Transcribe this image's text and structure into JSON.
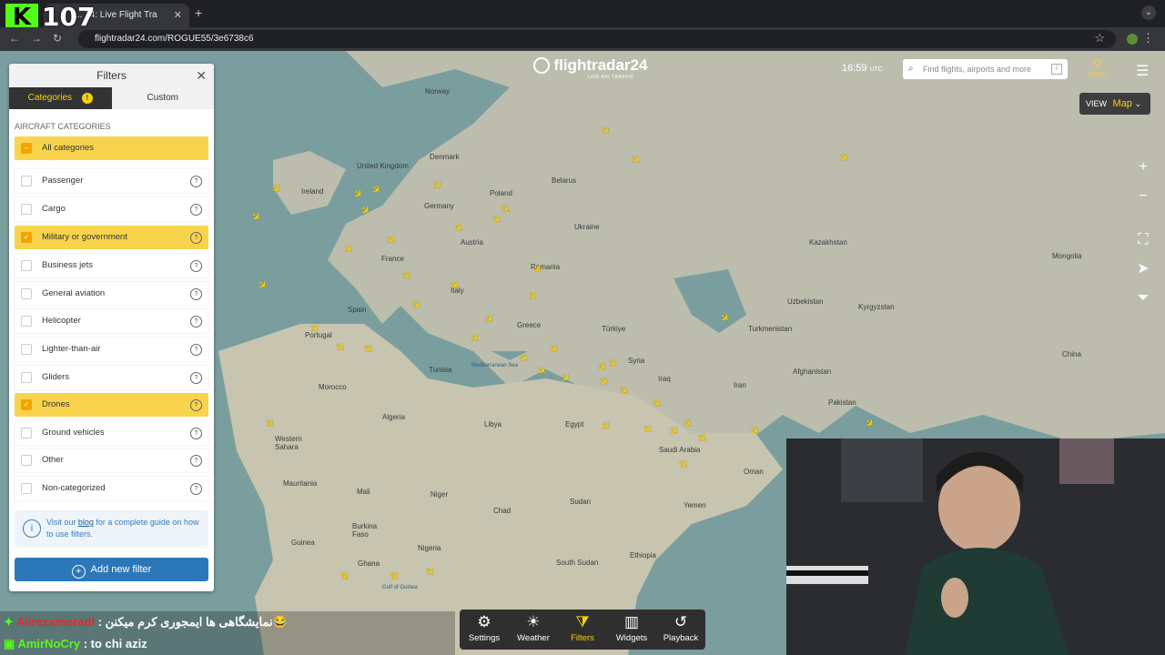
{
  "browser": {
    "tab_title": "... 24: Live Flight Tra",
    "tab_close": "✕",
    "new_tab": "+",
    "url": "flightradar24.com/ROGUE55/3e6738c6",
    "stream_brand": "K",
    "viewer_count": "107"
  },
  "header": {
    "logo": "flightradar24",
    "logo_sub": "LIVE AIR TRAFFIC",
    "time": "16:59",
    "time_zone": "UTC",
    "search_placeholder": "Find flights, airports and more",
    "search_key": "/",
    "gold_label": "GOLD",
    "view_label": "VIEW",
    "view_value": "Map"
  },
  "filters": {
    "title": "Filters",
    "tabs": [
      "Categories",
      "Custom"
    ],
    "tab_warning": "!",
    "section_title": "AIRCRAFT CATEGORIES",
    "categories": [
      {
        "label": "All categories",
        "state": "partial"
      },
      {
        "label": "Passenger",
        "state": "off"
      },
      {
        "label": "Cargo",
        "state": "off"
      },
      {
        "label": "Military or government",
        "state": "on"
      },
      {
        "label": "Business jets",
        "state": "off"
      },
      {
        "label": "General aviation",
        "state": "off"
      },
      {
        "label": "Helicopter",
        "state": "off"
      },
      {
        "label": "Lighter-than-air",
        "state": "off"
      },
      {
        "label": "Gliders",
        "state": "off"
      },
      {
        "label": "Drones",
        "state": "on"
      },
      {
        "label": "Ground vehicles",
        "state": "off"
      },
      {
        "label": "Other",
        "state": "off"
      },
      {
        "label": "Non-categorized",
        "state": "off"
      }
    ],
    "info_prefix": "Visit our ",
    "info_link": "blog",
    "info_suffix": " for a complete guide on how to use filters.",
    "add_button": "Add new filter"
  },
  "map_labels": [
    "Norway",
    "Denmark",
    "United Kingdom",
    "Ireland",
    "Belarus",
    "Poland",
    "Germany",
    "Ukraine",
    "Austria",
    "France",
    "Romania",
    "Italy",
    "Spain",
    "Portugal",
    "Greece",
    "Türkiye",
    "Morocco",
    "Tunisia",
    "Algeria",
    "Libya",
    "Egypt",
    "Syria",
    "Iraq",
    "Iran",
    "Kazakhstan",
    "Mongolia",
    "Uzbekistan",
    "Kyrgyzstan",
    "Turkmenistan",
    "Afghanistan",
    "Pakistan",
    "China",
    "Saudi Arabia",
    "Western Sahara",
    "Mauritania",
    "Mali",
    "Niger",
    "Chad",
    "Sudan",
    "Yemen",
    "Oman",
    "Ethiopia",
    "South Sudan",
    "Burkina Faso",
    "Nigeria",
    "Guinea",
    "Ghana",
    "Mediterranean Sea",
    "Gulf of Guinea"
  ],
  "toolbar": [
    {
      "label": "Settings",
      "icon": "gear-icon",
      "glyph": "⚙"
    },
    {
      "label": "Weather",
      "icon": "weather-icon",
      "glyph": "☀"
    },
    {
      "label": "Filters",
      "icon": "filter-icon",
      "glyph": "⧩"
    },
    {
      "label": "Widgets",
      "icon": "widgets-icon",
      "glyph": "▥"
    },
    {
      "label": "Playback",
      "icon": "playback-icon",
      "glyph": "↺"
    }
  ],
  "chat": [
    {
      "user": "Alirezamoradi",
      "text": "😂نمایشگاهی ها ایمجوری کرم میکنن : "
    },
    {
      "user": "AmirNoCry",
      "text": " : to chi aziz"
    }
  ],
  "colors": {
    "accent": "#f5d20f",
    "panel_check": "#f0a500",
    "button": "#2c77b8",
    "map_sea": "#7a9e9e",
    "map_land": "#bdbdae"
  }
}
